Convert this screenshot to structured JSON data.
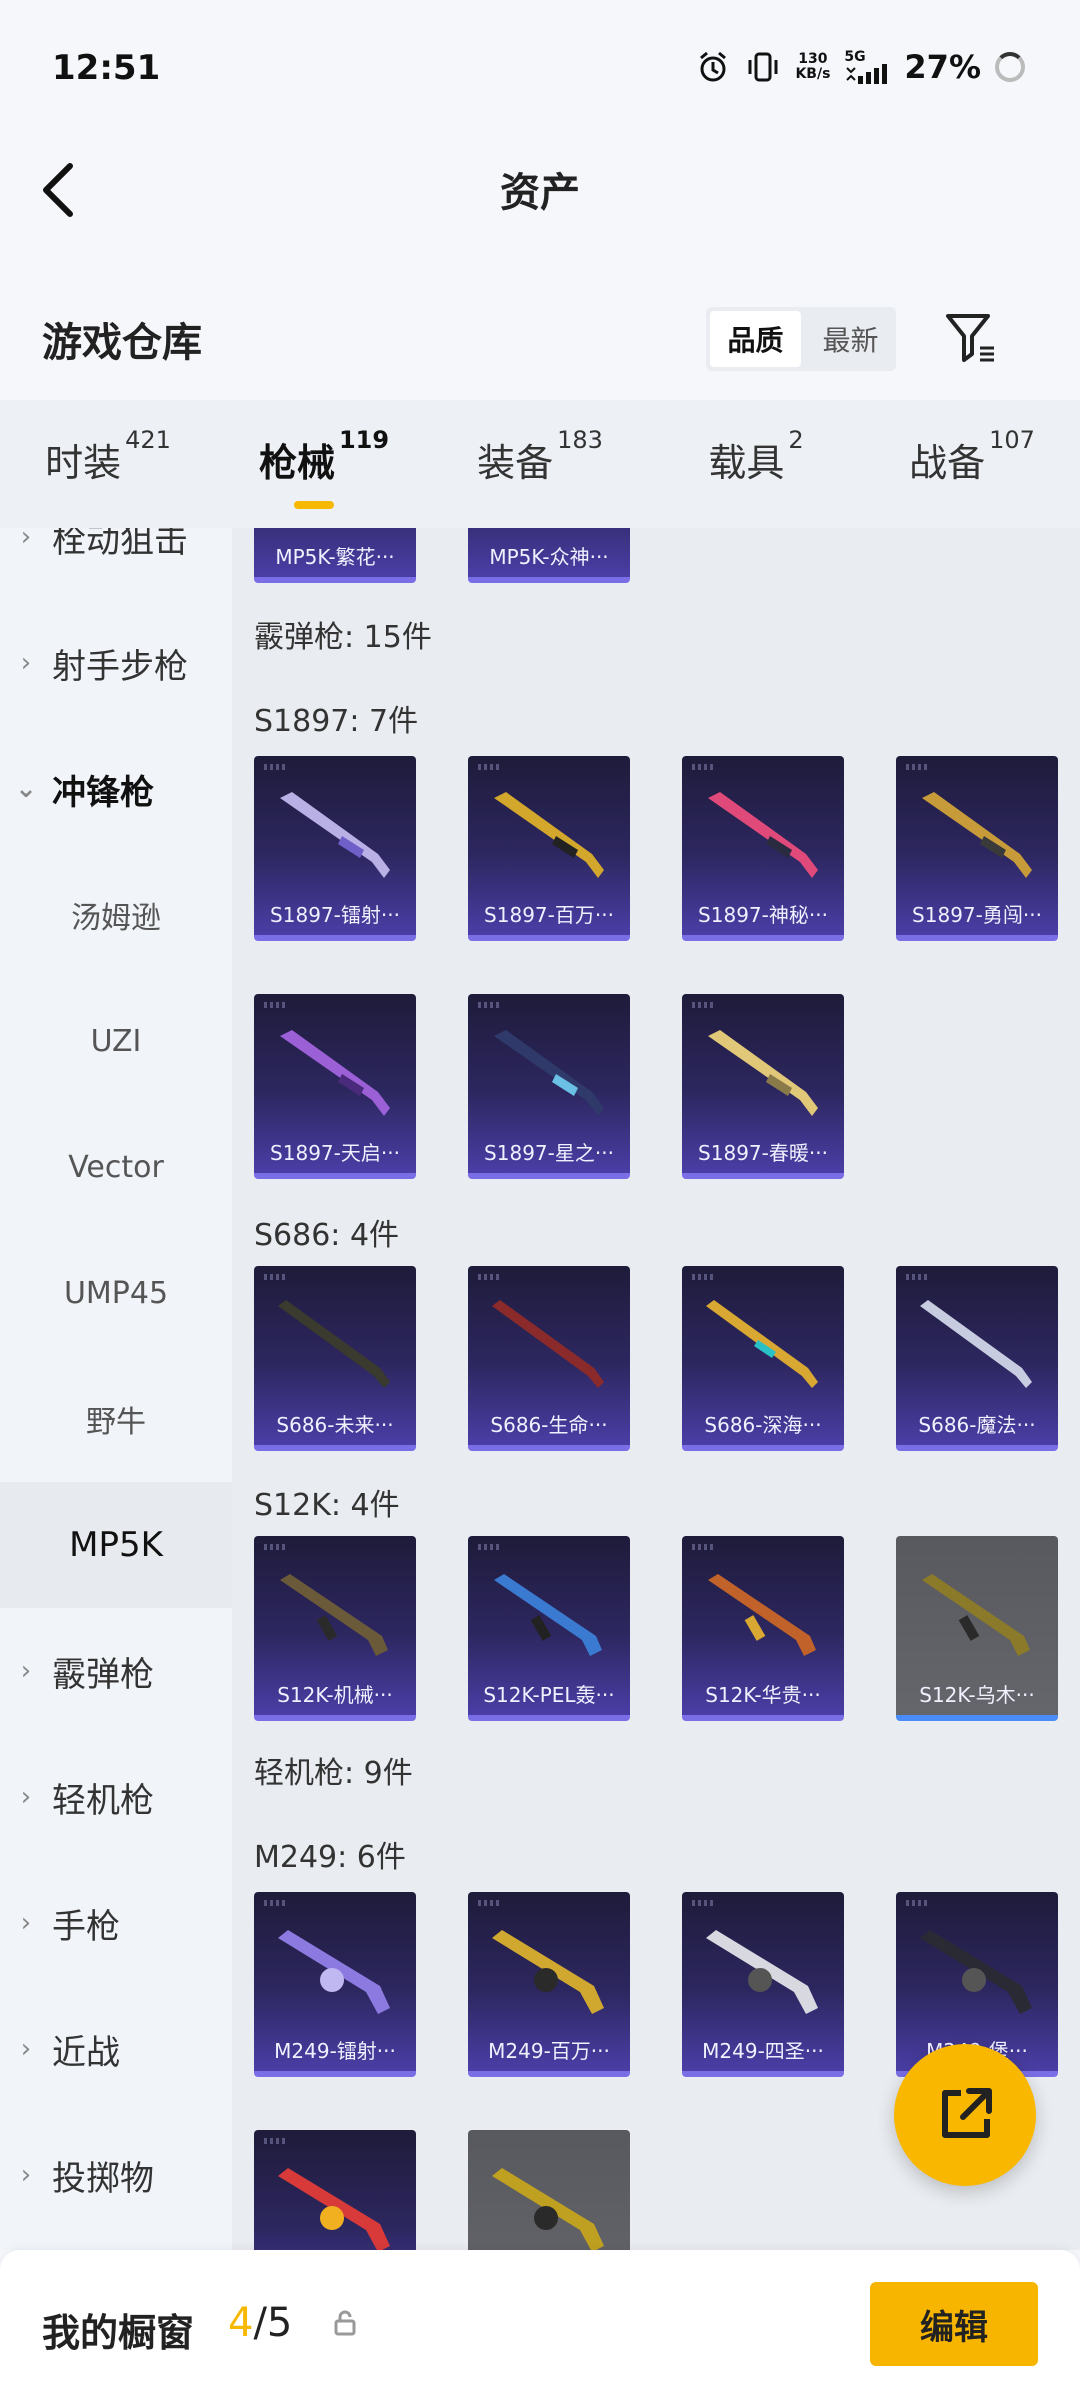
{
  "status_bar": {
    "time": "12:51",
    "net_speed": "130",
    "net_unit": "KB/s",
    "network": "5G",
    "battery": "27%"
  },
  "nav": {
    "title": "资产"
  },
  "section": {
    "title": "游戏仓库",
    "sort_options": [
      "品质",
      "最新"
    ]
  },
  "tabs": [
    {
      "label": "时装",
      "count": "421"
    },
    {
      "label": "枪械",
      "count": "119"
    },
    {
      "label": "装备",
      "count": "183"
    },
    {
      "label": "载具",
      "count": "2"
    },
    {
      "label": "战备",
      "count": "107"
    }
  ],
  "sidebar": {
    "items": [
      {
        "label": "栓动狙击"
      },
      {
        "label": "射手步枪"
      },
      {
        "label": "冲锋枪"
      },
      {
        "label": "汤姆逊"
      },
      {
        "label": "UZI"
      },
      {
        "label": "Vector"
      },
      {
        "label": "UMP45"
      },
      {
        "label": "野牛"
      },
      {
        "label": "MP5K"
      },
      {
        "label": "霰弹枪"
      },
      {
        "label": "轻机枪"
      },
      {
        "label": "手枪"
      },
      {
        "label": "近战"
      },
      {
        "label": "投掷物"
      }
    ]
  },
  "main": {
    "top_cards": [
      "MP5K-繁花···",
      "MP5K-众神···"
    ],
    "shotgun_header": "霰弹枪: 15件",
    "s1897_header": "S1897: 7件",
    "s1897_cards": [
      "S1897-镭射···",
      "S1897-百万···",
      "S1897-神秘···",
      "S1897-勇闯···",
      "S1897-天启···",
      "S1897-星之···",
      "S1897-春暖···"
    ],
    "s686_header": "S686: 4件",
    "s686_cards": [
      "S686-未来···",
      "S686-生命···",
      "S686-深海···",
      "S686-魔法···"
    ],
    "s12k_header": "S12K: 4件",
    "s12k_cards": [
      "S12K-机械···",
      "S12K-PEL轰···",
      "S12K-华贵···",
      "S12K-乌木···"
    ],
    "lmg_header": "轻机枪: 9件",
    "m249_header": "M249: 6件",
    "m249_cards": [
      "M249-镭射···",
      "M249-百万···",
      "M249-四圣···",
      "M249-堡···"
    ]
  },
  "bottom_bar": {
    "title": "我的橱窗",
    "count_current": "4",
    "count_total": "/5",
    "edit_label": "编辑"
  },
  "colors": {
    "accent": "#F7B500",
    "card_dark": "#2D2760",
    "card_border": "#7A6EE6"
  }
}
